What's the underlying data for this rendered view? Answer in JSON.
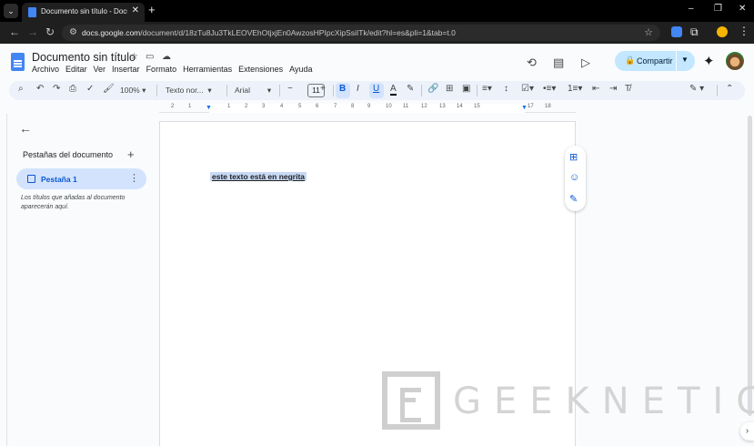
{
  "browser": {
    "tab_title": "Documento sin título - Docume",
    "url_host": "docs.google.com",
    "url_path": "/document/d/18zTu8Ju3TkLEOVEhOtjxjEn0AwzosHPIpcXipSsiITk/edit?hl=es&pli=1&tab=t.0",
    "new_tab": "+",
    "minimize": "–",
    "restore": "❐",
    "close": "✕"
  },
  "docs": {
    "title": "Documento sin título",
    "menu": [
      "Archivo",
      "Editar",
      "Ver",
      "Insertar",
      "Formato",
      "Herramientas",
      "Extensiones",
      "Ayuda"
    ],
    "share_label": "Compartir"
  },
  "toolbar": {
    "zoom": "100%",
    "style": "Texto nor...",
    "font": "Arial",
    "font_size": "11",
    "bold": "B",
    "italic": "I",
    "underline": "U",
    "text_color": "A"
  },
  "ruler": {
    "numbers": [
      "2",
      "1",
      "1",
      "2",
      "3",
      "4",
      "5",
      "6",
      "7",
      "8",
      "9",
      "10",
      "11",
      "12",
      "13",
      "14",
      "15",
      "16",
      "17",
      "18"
    ]
  },
  "sidebar": {
    "heading": "Pestañas del documento",
    "tab_label": "Pestaña 1",
    "hint": "Los títulos que añadas al documento aparecerán aquí."
  },
  "document": {
    "text": "este texto está en negrita"
  },
  "watermark": {
    "text": "GEEKNETIC"
  },
  "colors": {
    "share_bg": "#c2e7ff",
    "tab_active_bg": "#d3e3fd",
    "accent": "#0b57d0",
    "selection": "#c8d9f6"
  }
}
